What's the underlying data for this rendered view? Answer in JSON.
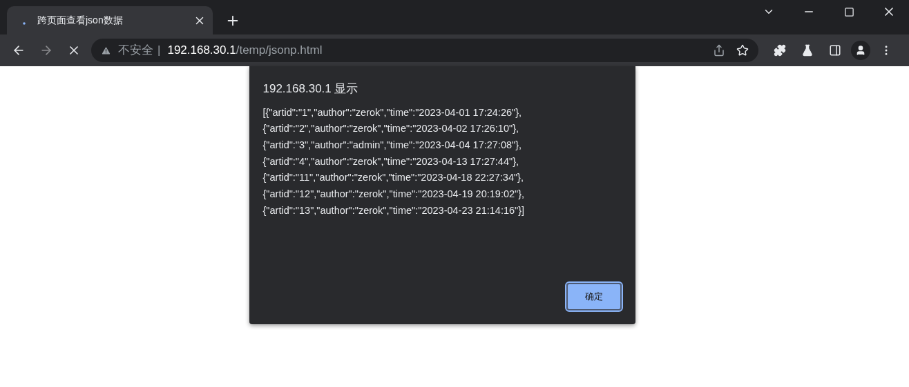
{
  "tab": {
    "title": "跨页面查看json数据",
    "loading": true
  },
  "address_bar": {
    "security_label": "不安全",
    "separator": "|",
    "url_host": "192.168.30.1",
    "url_path": "/temp/jsonp.html"
  },
  "dialog": {
    "title": "192.168.30.1 显示",
    "message_lines": [
      "[{\"artid\":\"1\",\"author\":\"zerok\",\"time\":\"2023-04-01 17:24:26\"},",
      "{\"artid\":\"2\",\"author\":\"zerok\",\"time\":\"2023-04-02 17:26:10\"},",
      "{\"artid\":\"3\",\"author\":\"admin\",\"time\":\"2023-04-04 17:27:08\"},",
      "{\"artid\":\"4\",\"author\":\"zerok\",\"time\":\"2023-04-13 17:27:44\"},",
      "{\"artid\":\"11\",\"author\":\"zerok\",\"time\":\"2023-04-18 22:27:34\"},",
      "{\"artid\":\"12\",\"author\":\"zerok\",\"time\":\"2023-04-19 20:19:02\"},",
      "{\"artid\":\"13\",\"author\":\"zerok\",\"time\":\"2023-04-23 21:14:16\"}]"
    ],
    "ok_button": "确定"
  }
}
